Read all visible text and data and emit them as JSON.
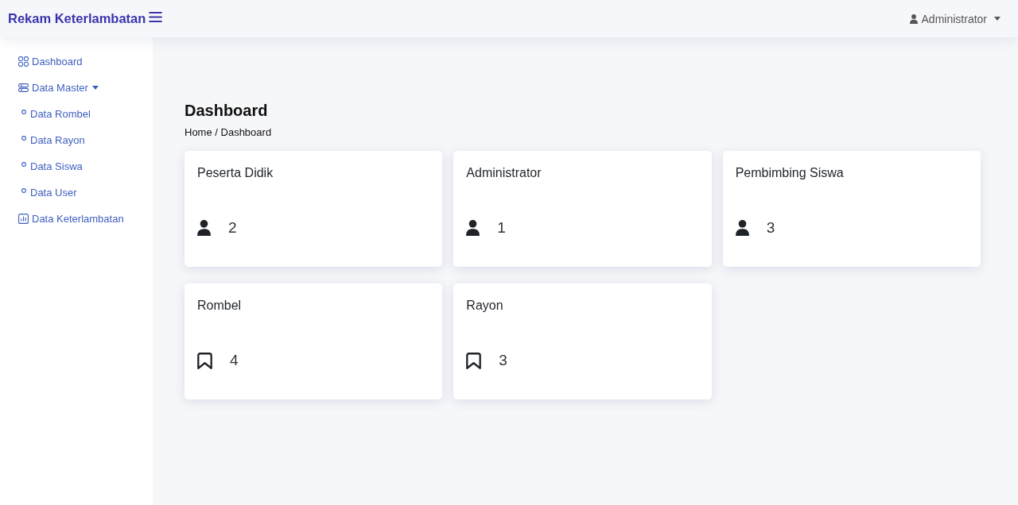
{
  "header": {
    "brand": "Rekam Keterlambatan",
    "user": {
      "name": "Administrator"
    }
  },
  "sidebar": {
    "items": [
      {
        "kind": "grid",
        "label": "Dashboard"
      },
      {
        "kind": "group",
        "label": "Data Master",
        "expanded": true,
        "children": [
          {
            "label": "Data Rombel"
          },
          {
            "label": "Data Rayon"
          },
          {
            "label": "Data Siswa"
          },
          {
            "label": "Data User"
          }
        ]
      },
      {
        "kind": "chart",
        "label": "Data Keterlambatan"
      }
    ]
  },
  "page": {
    "title": "Dashboard",
    "breadcrumb": "Home / Dashboard"
  },
  "cards": [
    {
      "title": "Peserta Didik",
      "kind": "person",
      "value": "2"
    },
    {
      "title": "Administrator",
      "kind": "person",
      "value": "1"
    },
    {
      "title": "Pembimbing Siswa",
      "kind": "person",
      "value": "3"
    },
    {
      "title": "Rombel",
      "kind": "bookmark",
      "value": "4"
    },
    {
      "title": "Rayon",
      "kind": "bookmark",
      "value": "3"
    }
  ]
}
